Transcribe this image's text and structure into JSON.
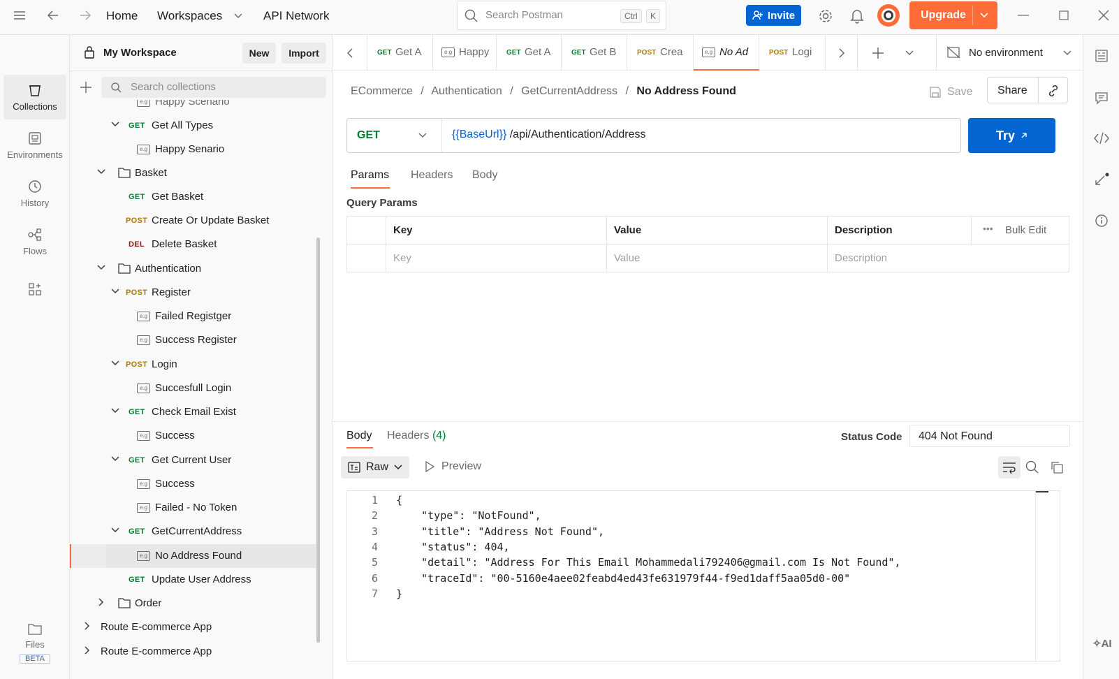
{
  "topbar": {
    "home": "Home",
    "workspaces": "Workspaces",
    "api_network": "API Network",
    "search_placeholder": "Search Postman",
    "kbd_ctrl": "Ctrl",
    "kbd_k": "K",
    "invite": "Invite",
    "upgrade": "Upgrade"
  },
  "rail": {
    "collections": "Collections",
    "environments": "Environments",
    "history": "History",
    "flows": "Flows",
    "files": "Files",
    "beta": "BETA"
  },
  "sidebar": {
    "workspace_name": "My Workspace",
    "new": "New",
    "import": "Import",
    "search_placeholder": "Search collections",
    "partial_top": "Happy Scenario",
    "items": [
      {
        "label": "Get All Types",
        "method": "GET"
      },
      {
        "label": "Happy Senario"
      },
      {
        "label": "Basket"
      },
      {
        "label": "Get Basket",
        "method": "GET"
      },
      {
        "label": "Create Or Update Basket",
        "method": "POST"
      },
      {
        "label": "Delete Basket",
        "method": "DEL"
      },
      {
        "label": "Authentication"
      },
      {
        "label": "Register",
        "method": "POST"
      },
      {
        "label": "Failed Registger"
      },
      {
        "label": "Success Register"
      },
      {
        "label": "Login",
        "method": "POST"
      },
      {
        "label": "Succesfull Login"
      },
      {
        "label": "Check Email Exist",
        "method": "GET"
      },
      {
        "label": "Success"
      },
      {
        "label": "Get Current User",
        "method": "GET"
      },
      {
        "label": "Success"
      },
      {
        "label": "Failed - No Token"
      },
      {
        "label": "GetCurrentAddress",
        "method": "GET"
      },
      {
        "label": "No Address Found"
      },
      {
        "label": "Update User Address",
        "method": "GET"
      },
      {
        "label": "Order"
      },
      {
        "label": "Route E-commerce App"
      },
      {
        "label": "Route E-commerce App"
      }
    ]
  },
  "tabs": [
    {
      "method": "GET",
      "label": "Get A"
    },
    {
      "method": "",
      "label": "Happy"
    },
    {
      "method": "GET",
      "label": "Get A"
    },
    {
      "method": "GET",
      "label": "Get B"
    },
    {
      "method": "POST",
      "label": "Crea"
    },
    {
      "method": "",
      "label": "No Ad"
    },
    {
      "method": "POST",
      "label": "Logi"
    }
  ],
  "environment": "No environment",
  "breadcrumb": {
    "c1": "ECommerce",
    "c2": "Authentication",
    "c3": "GetCurrentAddress",
    "current": "No Address Found",
    "sep": "/"
  },
  "actions": {
    "save": "Save",
    "share": "Share"
  },
  "request": {
    "method": "GET",
    "base_var": "{{BaseUrl}}",
    "path": "/api/Authentication/Address",
    "try": "Try"
  },
  "req_tabs": {
    "params": "Params",
    "headers": "Headers",
    "body": "Body"
  },
  "query_params": {
    "title": "Query Params",
    "col_key": "Key",
    "col_value": "Value",
    "col_desc": "Description",
    "bulk_edit": "Bulk Edit",
    "ph_key": "Key",
    "ph_value": "Value",
    "ph_desc": "Description"
  },
  "response": {
    "tab_body": "Body",
    "tab_headers": "Headers",
    "headers_count": "(4)",
    "status_label": "Status Code",
    "status_value": "404 Not Found",
    "format": "Raw",
    "preview": "Preview",
    "lines": [
      "{",
      "    \"type\": \"NotFound\",",
      "    \"title\": \"Address Not Found\",",
      "    \"status\": 404,",
      "    \"detail\": \"Address For This Email Mohammedali792406@gmail.com Is Not Found\",",
      "    \"traceId\": \"00-5160e4aee02feabd4ed43fe631979f44-f9ed1daff5aa05d0-00\"",
      "}"
    ]
  },
  "colors": {
    "accent": "#ff6c37",
    "primary_blue": "#0265d2",
    "get": "#007f31",
    "post": "#ad7a03",
    "del": "#8e1a10"
  }
}
